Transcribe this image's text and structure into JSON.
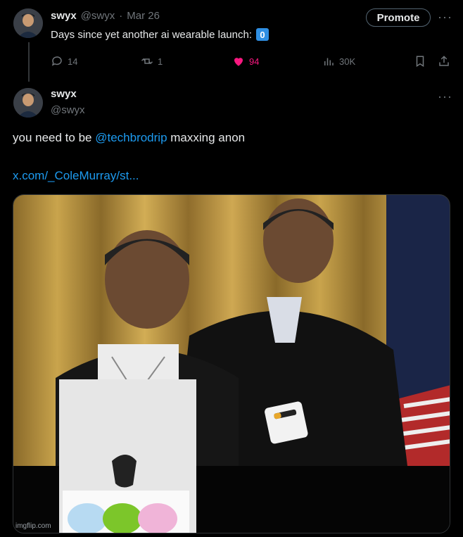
{
  "tweet1": {
    "display_name": "swyx",
    "handle": "@swyx",
    "separator": "·",
    "date": "Mar 26",
    "text": "Days since yet another ai wearable launch:",
    "badge": "0",
    "promote_label": "Promote",
    "more_label": "···",
    "stats": {
      "replies": "14",
      "reposts": "1",
      "likes": "94",
      "views": "30K"
    }
  },
  "tweet2": {
    "display_name": "swyx",
    "handle": "@swyx",
    "more_label": "···",
    "text_before": "you need to be ",
    "mention": "@techbrodrip",
    "text_after": " maxxing anon",
    "link": "x.com/_ColeMurray/st...",
    "watermark": "imgflip.com"
  },
  "icons": [
    "reply-icon",
    "repost-icon",
    "like-icon",
    "views-icon",
    "bookmark-icon",
    "share-icon"
  ],
  "colors": {
    "background": "#000000",
    "text": "#e7e9ea",
    "muted": "#71767b",
    "link": "#1d9bf0",
    "like": "#f91880",
    "badge": "#2f8fe3"
  }
}
